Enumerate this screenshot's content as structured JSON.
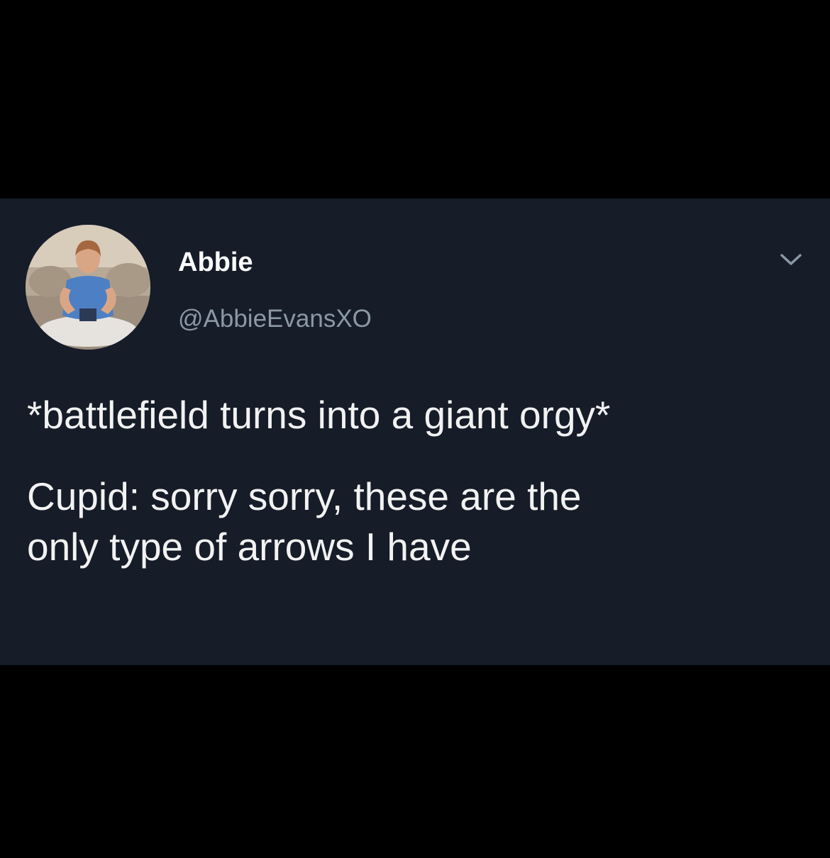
{
  "tweet": {
    "display_name": "Abbie",
    "handle": "@AbbieEvansXO",
    "text_lines": [
      "*battlefield turns into a giant orgy*",
      "Cupid: sorry sorry, these are the",
      "only type of arrows I have"
    ]
  },
  "icons": {
    "menu": "chevron-down-icon",
    "avatar": "avatar"
  },
  "colors": {
    "page_background": "#000000",
    "card_background": "#161c28",
    "name": "#ffffff",
    "handle": "#8b98a5",
    "text": "#f2f2f2"
  }
}
